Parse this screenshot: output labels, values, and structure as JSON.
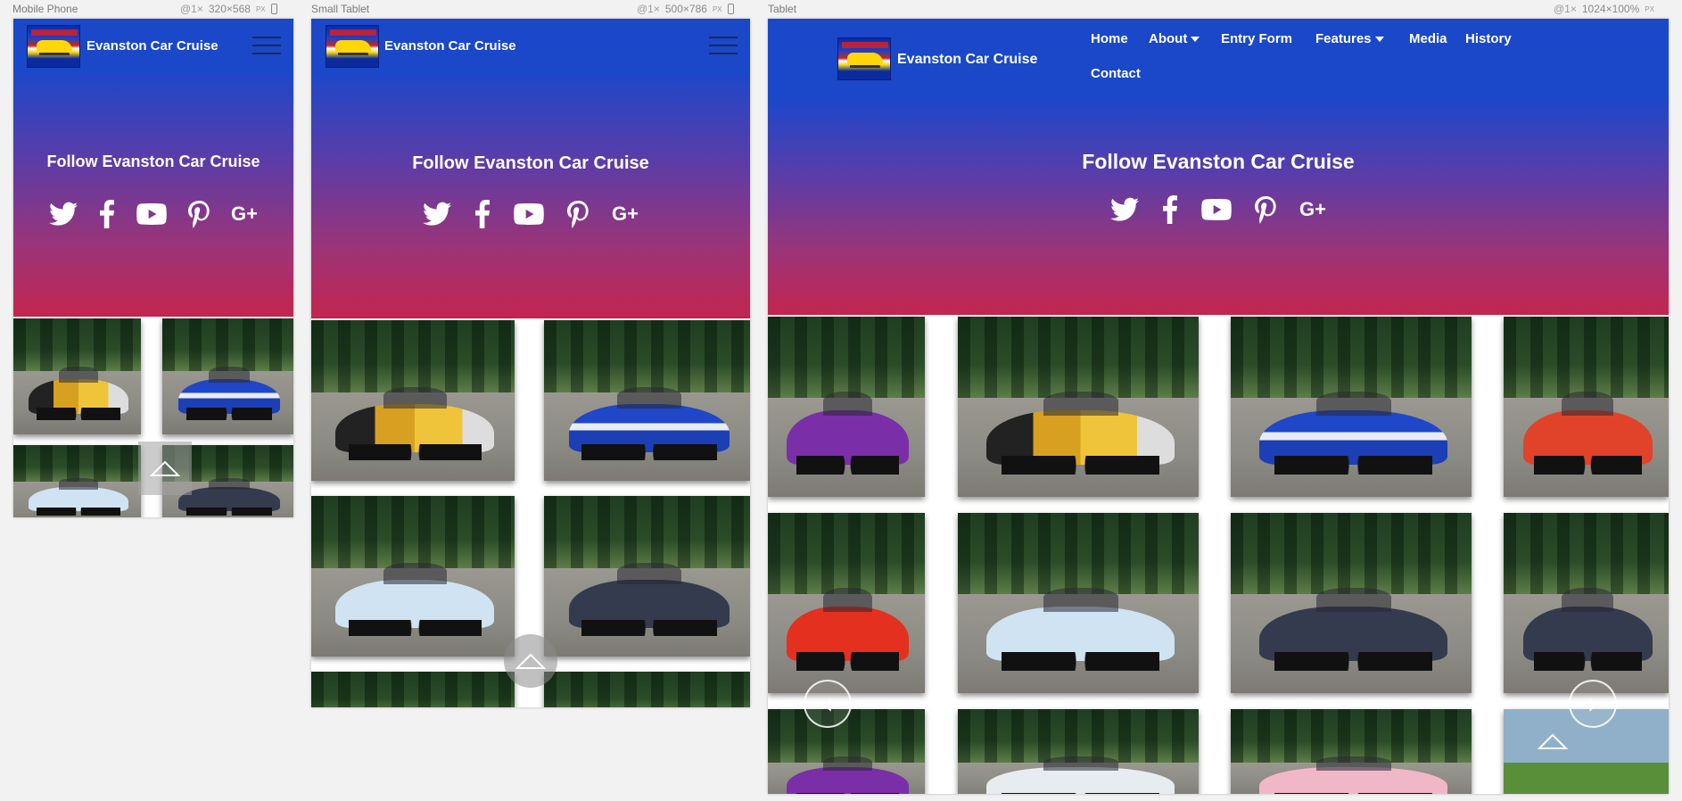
{
  "frames": [
    {
      "label": "Mobile Phone",
      "zoom": "@1×",
      "size": "320×568",
      "unit": "PX"
    },
    {
      "label": "Small Tablet",
      "zoom": "@1×",
      "size": "500×786",
      "unit": "PX"
    },
    {
      "label": "Tablet",
      "zoom": "@1×",
      "size": "1024×100%",
      "unit": "PX"
    }
  ],
  "site": {
    "brand": "Evanston Car Cruise",
    "follow_heading": "Follow Evanston Car Cruise",
    "social_icons": [
      "twitter-icon",
      "facebook-icon",
      "youtube-icon",
      "pinterest-icon",
      "google-plus-icon"
    ],
    "google_plus_text": "G+",
    "nav": [
      {
        "label": "Home",
        "has_dropdown": false
      },
      {
        "label": "About",
        "has_dropdown": true
      },
      {
        "label": "Entry Form",
        "has_dropdown": false
      },
      {
        "label": "Features",
        "has_dropdown": true
      },
      {
        "label": "Media",
        "has_dropdown": false
      },
      {
        "label": "History",
        "has_dropdown": false
      },
      {
        "label": "Contact",
        "has_dropdown": false
      }
    ]
  },
  "colors": {
    "header_blue": "#1a48c8",
    "gradient_top": "#1e47c9",
    "gradient_bottom": "#c4254f",
    "canvas_bg": "#f2f2f2"
  },
  "slider_controls": {
    "prev": "‹",
    "next": "›"
  }
}
